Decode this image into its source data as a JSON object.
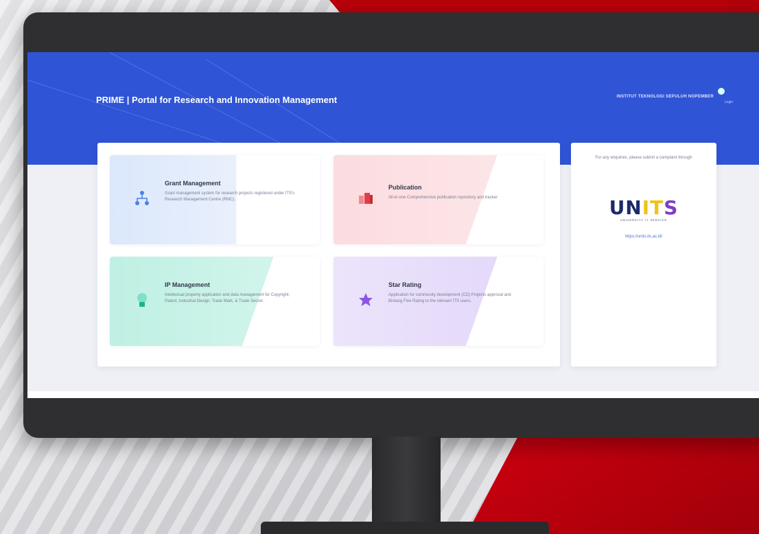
{
  "portal": {
    "title": "PRIME | Portal for Research and Innovation Management",
    "header_right": "INSTITUT TEKNOLOGI SEPULUH NOPEMBER",
    "user_label": "Login"
  },
  "cards": [
    {
      "title": "Grant Management",
      "desc": "Grant management system for research projects registered under ITS's Research Management Centre (RMC).",
      "icon": "hierarchy-icon",
      "color": "#4a80e8"
    },
    {
      "title": "Publication",
      "desc": "All-in-one Comprehensive publication repository and tracker",
      "icon": "books-icon",
      "color": "#ea4f5a"
    },
    {
      "title": "IP Management",
      "desc": "Intellectual property application and data management for Copyright, Patent, Industrial Design, Trade Mark, & Trade Secret.",
      "icon": "lightbulb-icon",
      "color": "#19b38f"
    },
    {
      "title": "Star Rating",
      "desc": "Application for community development (CD) Projects approval and Bintang Five Rating to the relevant ITS users.",
      "icon": "star-icon",
      "color": "#8a55e6"
    }
  ],
  "side": {
    "message": "For any enquiries, please submit a complaint through",
    "logo_text": "UNITS",
    "logo_sub": "UNIVERSITY IT SERVICE",
    "link": "https://units.its.ac.id/"
  },
  "colors": {
    "header": "#2f54d6",
    "accent_red": "#c0000c"
  }
}
